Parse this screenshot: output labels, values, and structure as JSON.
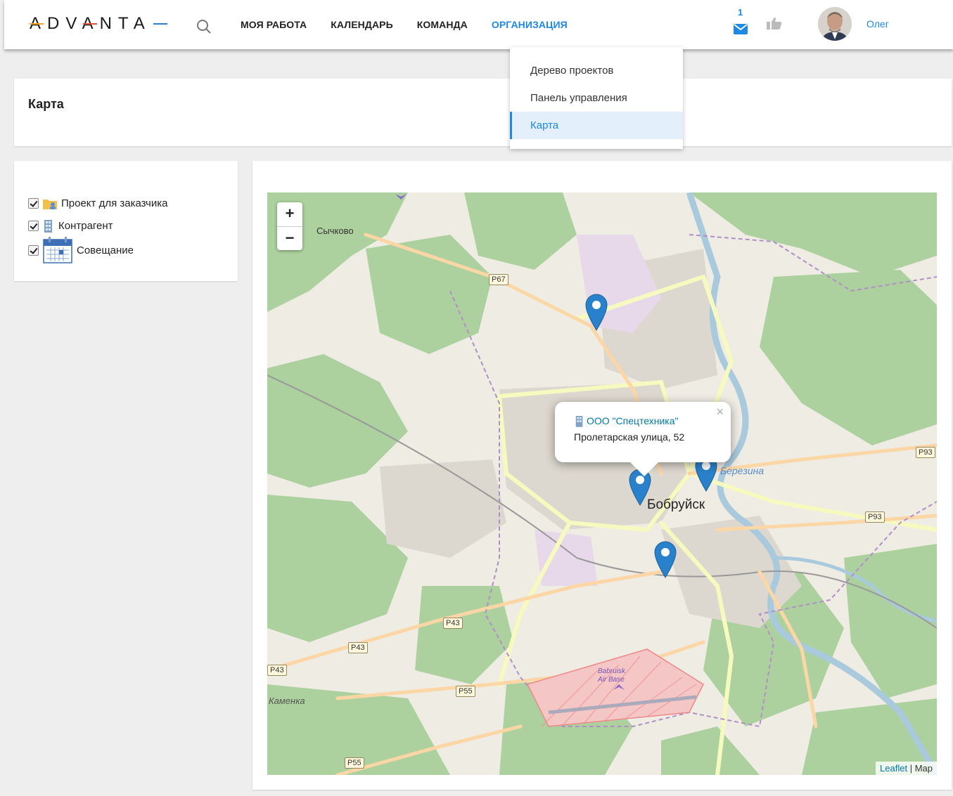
{
  "header": {
    "logo": "ADVANTA",
    "nav": [
      "МОЯ РАБОТА",
      "КАЛЕНДАРЬ",
      "КОМАНДА",
      "ОРГАНИЗАЦИЯ"
    ],
    "active_nav": "ОРГАНИЗАЦИЯ",
    "notification_count": "1",
    "user_name": "Олег"
  },
  "dropdown": {
    "items": [
      "Дерево проектов",
      "Панель управления",
      "Карта"
    ],
    "selected": "Карта"
  },
  "page": {
    "title": "Карта"
  },
  "filters": {
    "items": [
      {
        "label": "Проект для заказчика",
        "checked": true,
        "icon": "folder-user-icon"
      },
      {
        "label": "Контрагент",
        "checked": true,
        "icon": "building-icon"
      },
      {
        "label": "Совещание",
        "checked": true,
        "icon": "calendar-icon"
      }
    ]
  },
  "map": {
    "zoom_in": "+",
    "zoom_out": "−",
    "labels": {
      "sychkovo": "Сычково",
      "bobruisk": "Бобруйск",
      "berezina": "Березина",
      "kamenka": "Каменка",
      "airbase_1": "Babruisk",
      "airbase_2": "Air Base"
    },
    "shields": {
      "p67": "P67",
      "p93a": "P93",
      "p93b": "P93",
      "p43a": "P43",
      "p43b": "P43",
      "p43c": "P43",
      "p55a": "P55",
      "p55b": "P55"
    },
    "popup": {
      "title": "ООО \"Спецтехника\"",
      "address": "Пролетарская улица, 52",
      "close": "×"
    },
    "attribution": {
      "leaflet": "Leaflet",
      "separator": " | ",
      "map": "Map"
    },
    "colors": {
      "marker": "#2a81cb",
      "forest": "#add19e",
      "road": "#f7fabf",
      "highway": "#fcd6a4"
    }
  }
}
